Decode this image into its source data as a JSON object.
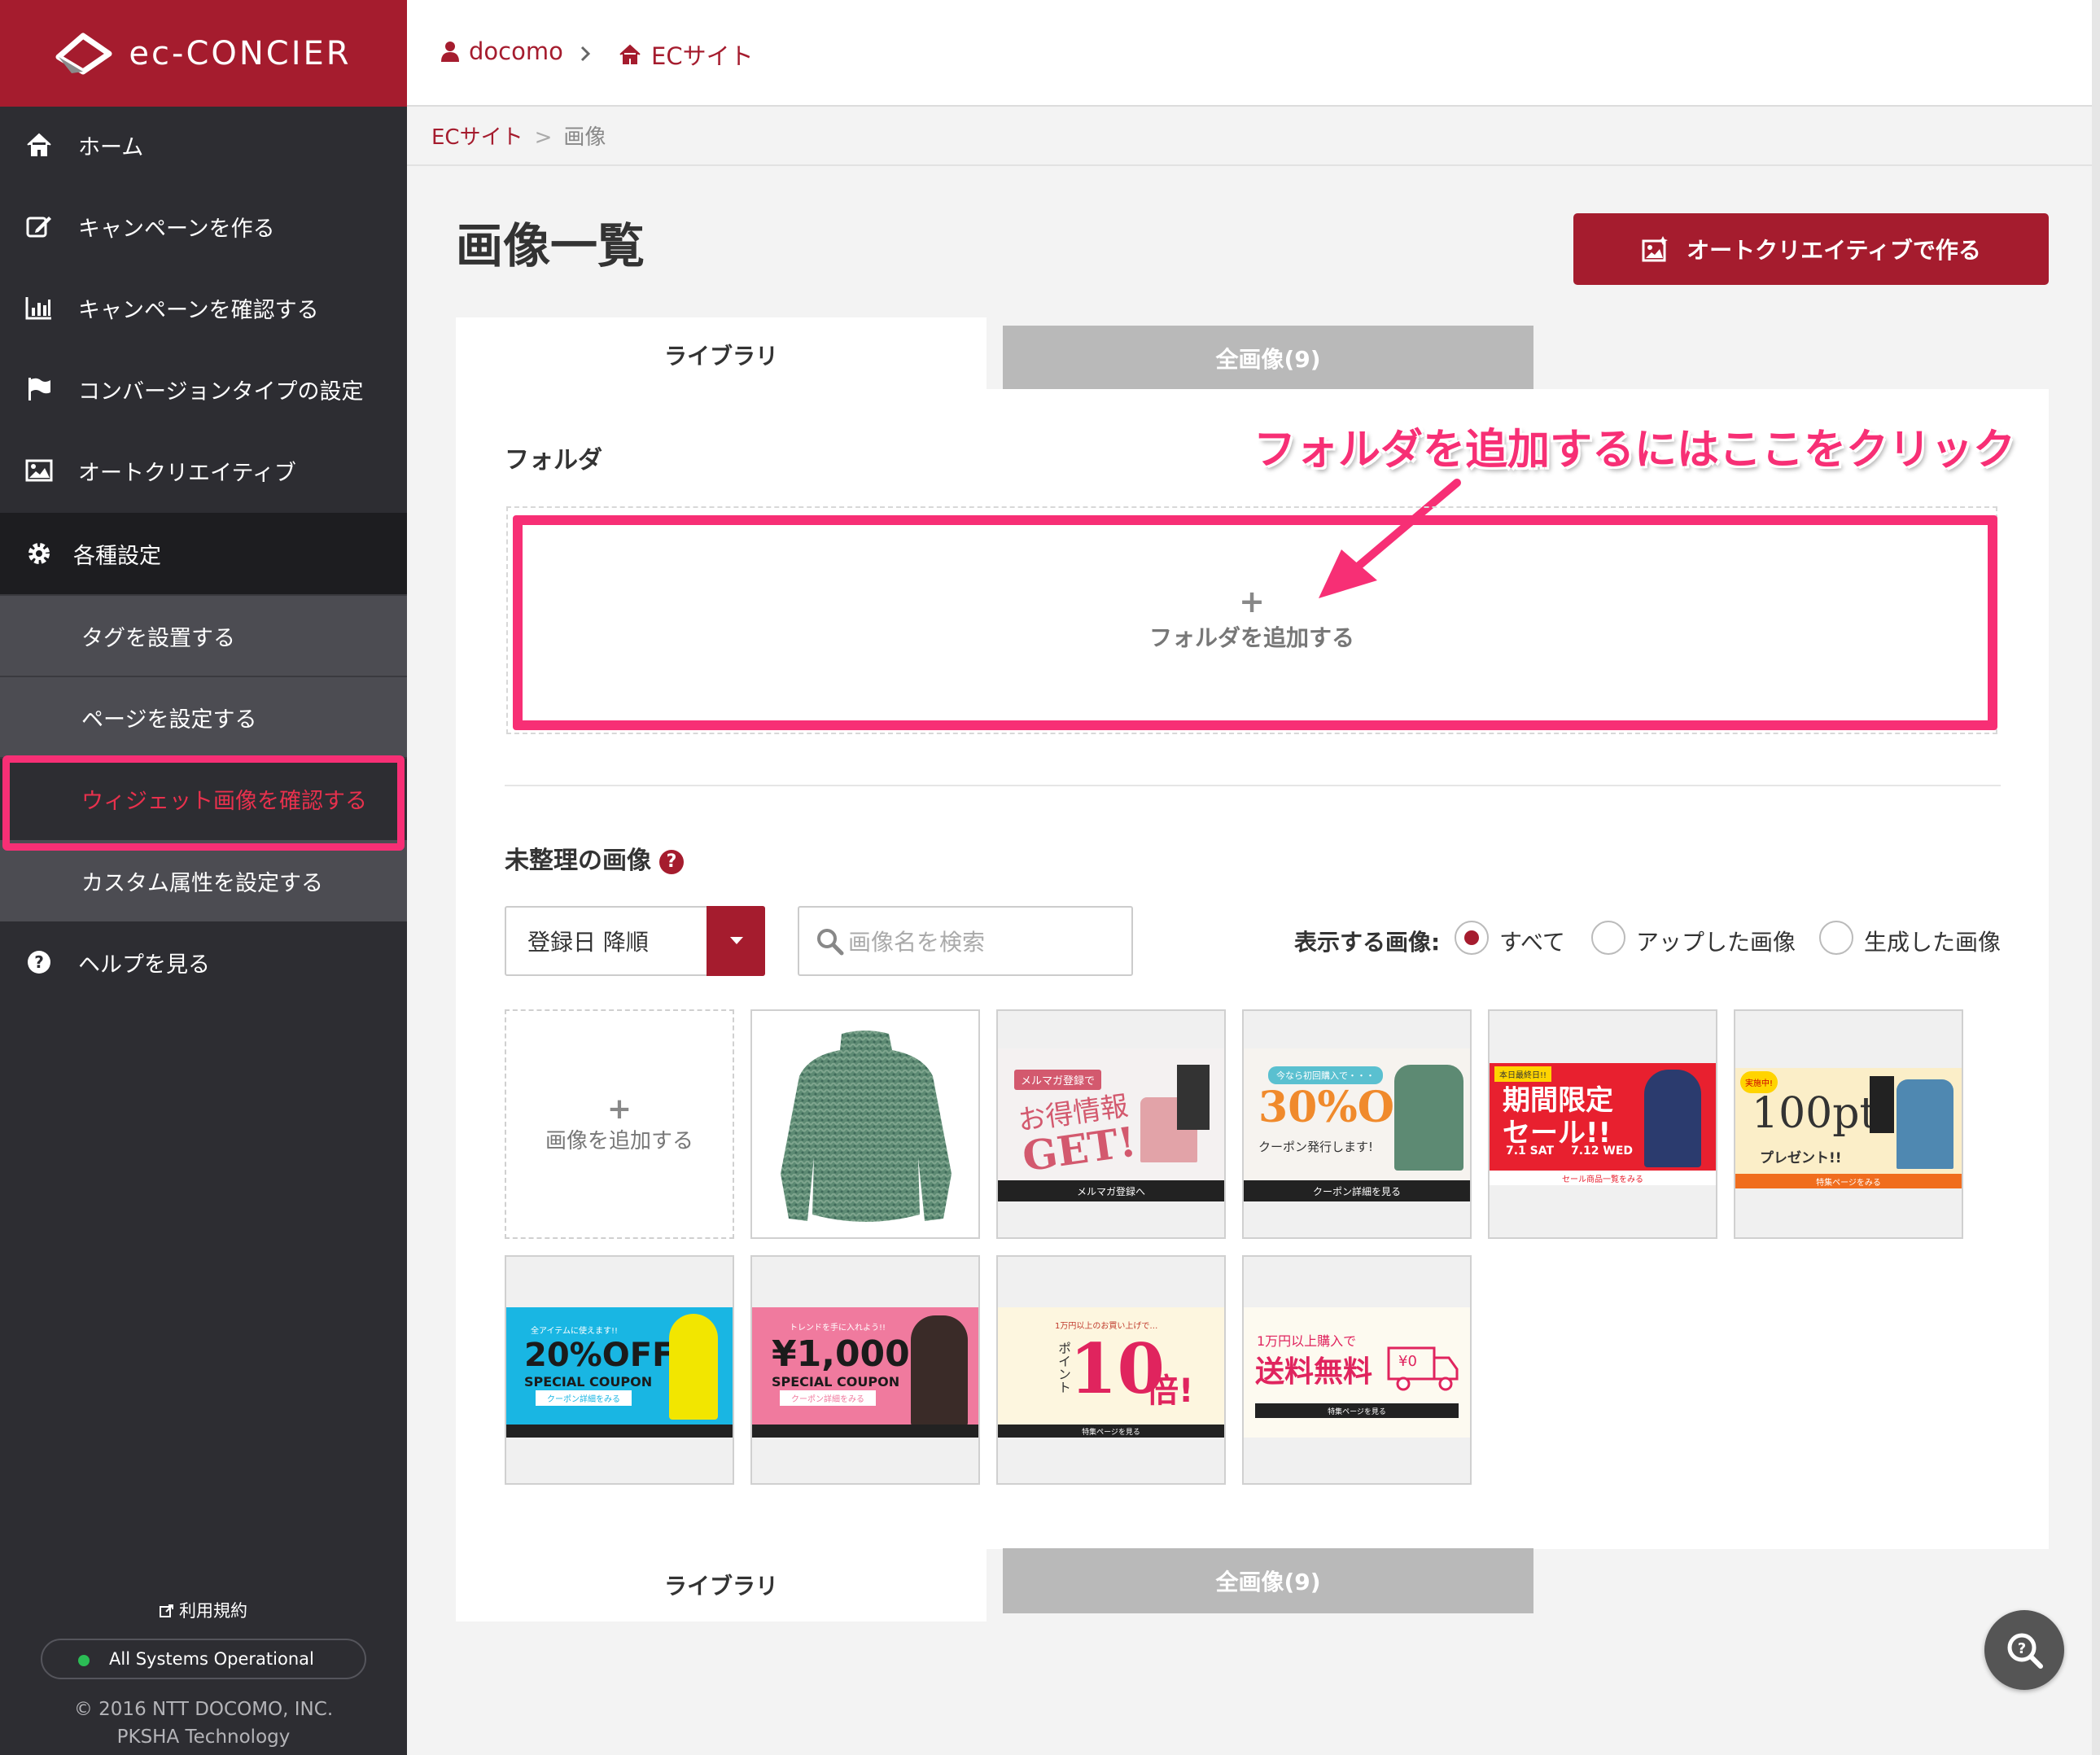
{
  "brand": {
    "logo_text": "ec-CONCIER",
    "accent": "#a51c2e",
    "highlight": "#f72f75"
  },
  "topbar": {
    "account": "docomo",
    "site": "ECサイト"
  },
  "sidebar": {
    "items": [
      {
        "icon": "home-icon",
        "label": "ホーム"
      },
      {
        "icon": "edit-icon",
        "label": "キャンペーンを作る"
      },
      {
        "icon": "bar-chart-icon",
        "label": "キャンペーンを確認する"
      },
      {
        "icon": "flag-icon",
        "label": "コンバージョンタイプの設定"
      },
      {
        "icon": "image-icon",
        "label": "オートクリエイティブ"
      },
      {
        "icon": "gear-icon",
        "label": "各種設定"
      }
    ],
    "sub_items": [
      "タグを設置する",
      "ページを設定する",
      "ウィジェット画像を確認する",
      "カスタム属性を設定する"
    ],
    "help": {
      "icon": "question-icon",
      "label": "ヘルプを見る"
    },
    "terms": "利用規約",
    "status": "All Systems Operational",
    "copyright_1": "© 2016 NTT DOCOMO, INC.",
    "copyright_2": "PKSHA Technology"
  },
  "breadcrumb": {
    "parent": "ECサイト",
    "separator": ">",
    "current": "画像"
  },
  "page": {
    "title": "画像一覧",
    "auto_button": "オートクリエイティブで作る",
    "tabs": [
      "ライブラリ",
      "全画像(9)"
    ],
    "folder_heading": "フォルダ",
    "callout": "フォルダを追加するにはここをクリック",
    "add_folder_plus": "+",
    "add_folder_label": "フォルダを追加する",
    "unsorted_heading": "未整理の画像",
    "sort_value": "登録日 降順",
    "search_placeholder": "画像名を検索",
    "filter_label": "表示する画像:",
    "filter_options": [
      "すべて",
      "アップした画像",
      "生成した画像"
    ],
    "filter_selected": "すべて",
    "add_image_plus": "+",
    "add_image_label": "画像を追加する"
  },
  "images": [
    {
      "name": "sweater"
    },
    {
      "name": "mailmag-banner",
      "texts": [
        "メルマガ登録で",
        "お得情報",
        "GET!",
        "メルマガ登録へ"
      ]
    },
    {
      "name": "30off-banner",
      "texts": [
        "今なら初回購入で・・・",
        "30%OFF",
        "クーポン発行します!",
        "クーポン詳細を見る"
      ]
    },
    {
      "name": "sale-banner",
      "texts": [
        "本日最終日!!",
        "期間限定",
        "セール!!",
        "7.1 SAT",
        "7.12 WED",
        "セール商品一覧をみる"
      ]
    },
    {
      "name": "100pt-banner",
      "texts": [
        "実施中!",
        "100pt",
        "プレゼント!!",
        "特集ページをみる"
      ]
    },
    {
      "name": "20off-coupon",
      "texts": [
        "全アイテムに使えます!!",
        "20%OFF",
        "SPECIAL COUPON",
        "クーポン詳細をみる"
      ]
    },
    {
      "name": "1000yen-coupon",
      "texts": [
        "トレンドを手に入れよう!!",
        "¥1,000",
        "SPECIAL COUPON",
        "クーポン詳細をみる"
      ]
    },
    {
      "name": "10x-point-banner",
      "texts": [
        "1万円以上のお買い上げで…",
        "ポイント",
        "10",
        "倍!",
        "特集ページを見る"
      ]
    },
    {
      "name": "free-shipping-banner",
      "texts": [
        "1万円以上購入で",
        "送料無料",
        "¥0",
        "特集ページを見る"
      ]
    }
  ]
}
